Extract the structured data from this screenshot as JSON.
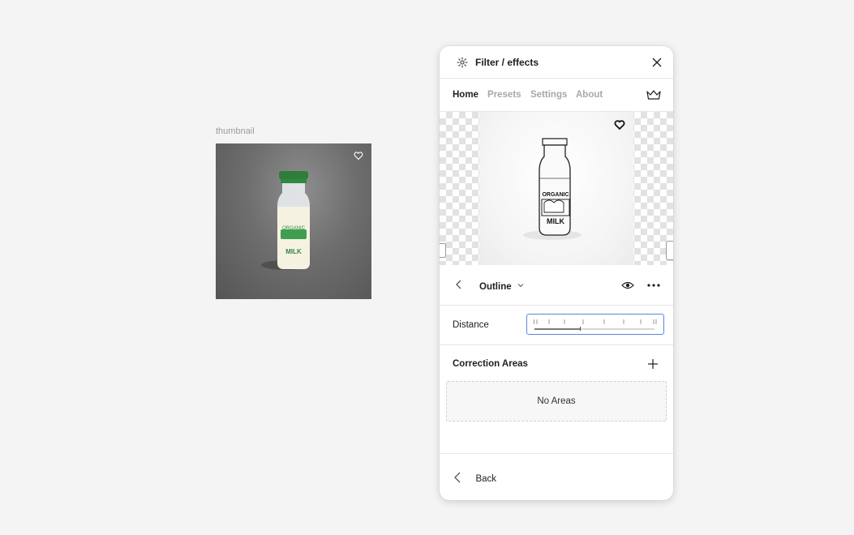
{
  "canvas": {
    "thumbnail_label": "thumbnail",
    "thumbnail_image": "organic-milk-bottle-photo",
    "favorite_icon": "heart-icon"
  },
  "panel": {
    "title": "Filter / effects",
    "plugin_icon": "sparkle-icon",
    "close_icon": "close-icon",
    "tabs": [
      {
        "label": "Home",
        "active": true
      },
      {
        "label": "Presets",
        "active": false
      },
      {
        "label": "Settings",
        "active": false
      },
      {
        "label": "About",
        "active": false
      }
    ],
    "crown_icon": "crown-icon",
    "preview": {
      "image": "organic-milk-bottle-outline-sketch",
      "favorite_icon": "heart-icon"
    },
    "effect": {
      "name": "Outline",
      "back_icon": "chevron-left-icon",
      "dropdown_icon": "chevron-down-icon",
      "visibility_icon": "eye-icon",
      "more_icon": "more-horizontal-icon"
    },
    "distance": {
      "label": "Distance",
      "value_fraction": 0.38
    },
    "correction_areas": {
      "heading": "Correction Areas",
      "add_icon": "plus-icon",
      "empty_text": "No Areas"
    },
    "footer": {
      "back_label": "Back",
      "back_icon": "chevron-left-icon"
    }
  }
}
